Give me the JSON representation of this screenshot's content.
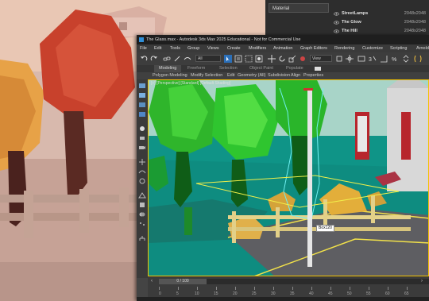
{
  "material_panel": {
    "dropdown_label": "Material",
    "rows": [
      {
        "name": "StreetLamps",
        "resolution": "2048x2048"
      },
      {
        "name": "The Glow",
        "resolution": "2048x2048"
      },
      {
        "name": "The Hill",
        "resolution": "2048x2048"
      }
    ]
  },
  "window": {
    "title": "The Glass.max - Autodesk 3ds Max 2025 Educational - Not for Commercial Use"
  },
  "menu": [
    "File",
    "Edit",
    "Tools",
    "Group",
    "Views",
    "Create",
    "Modifiers",
    "Animation",
    "Graph Editors",
    "Rendering",
    "Customize",
    "Scripting",
    "Arnold"
  ],
  "toolbar": {
    "selection_filter": "All",
    "reference_coord": "View"
  },
  "ribbon_tabs": [
    "Modeling",
    "Freeform",
    "Selection",
    "Object Paint",
    "Populate"
  ],
  "ribbon_items": [
    "Polygon Modeling",
    "Modify Selection",
    "Edit",
    "Geometry (All)",
    "Subdivision",
    "Align",
    "Properties"
  ],
  "viewport": {
    "label": "[+] [Perspective] [Standard] [Default Shading]",
    "tooltip": "Box120"
  },
  "timeline": {
    "frame_indicator": "0 / 100",
    "ticks": [
      "0",
      "5",
      "10",
      "15",
      "20",
      "25",
      "30",
      "35",
      "40",
      "45",
      "50",
      "55",
      "60",
      "65"
    ]
  },
  "colors": {
    "viewport_bg": "#0f9487",
    "ui_dark": "#3b3b3b",
    "selection_yellow": "#f2c200"
  }
}
